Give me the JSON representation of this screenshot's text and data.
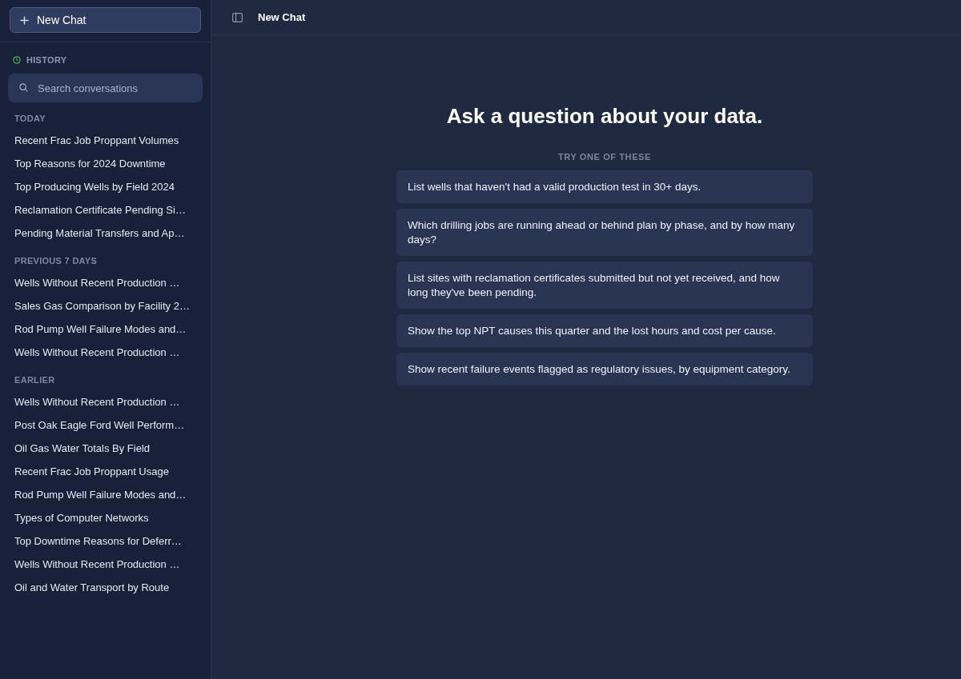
{
  "sidebar": {
    "new_chat_button": {
      "label": "New Chat"
    },
    "history": {
      "title": "HISTORY",
      "search": {
        "placeholder": "Search conversations"
      },
      "groups": [
        {
          "title": "TODAY",
          "items": [
            {
              "label": "Recent Frac Job Proppant Volumes",
              "selected": false
            },
            {
              "label": "Top Reasons for 2024 Downtime",
              "selected": false
            },
            {
              "label": "Top Producing Wells by Field 2024",
              "selected": false
            },
            {
              "label": "Reclamation Certificate Pending Si…",
              "selected": false
            },
            {
              "label": "Pending Material Transfers and Ap…",
              "selected": false
            }
          ]
        },
        {
          "title": "PREVIOUS 7 DAYS",
          "items": [
            {
              "label": "Wells Without Recent Production …",
              "selected": false
            },
            {
              "label": "Sales Gas Comparison by Facility 2…",
              "selected": false
            },
            {
              "label": "Rod Pump Well Failure Modes and…",
              "selected": false
            },
            {
              "label": "Wells Without Recent Production …",
              "selected": false
            }
          ]
        },
        {
          "title": "EARLIER",
          "items": [
            {
              "label": "Wells Without Recent Production …",
              "selected": false
            },
            {
              "label": "Post Oak Eagle Ford Well Perform…",
              "selected": false
            },
            {
              "label": "Oil Gas Water Totals By Field",
              "selected": false
            },
            {
              "label": "Recent Frac Job Proppant Usage",
              "selected": false
            },
            {
              "label": "Rod Pump Well Failure Modes and…",
              "selected": false
            },
            {
              "label": "Types of Computer Networks",
              "selected": false
            },
            {
              "label": "Top Downtime Reasons for Deferr…",
              "selected": false
            },
            {
              "label": "Wells Without Recent Production …",
              "selected": false
            },
            {
              "label": "Oil and Water Transport by Route",
              "selected": false
            }
          ]
        }
      ]
    }
  },
  "header": {
    "title": "New Chat"
  },
  "main": {
    "heading": "Ask a question about your data.",
    "suggestions_title": "TRY ONE OF THESE",
    "suggestions": [
      "List wells that haven't had a valid production test in 30+ days.",
      "Which drilling jobs are running ahead or behind plan by phase, and by how many days?",
      "List sites with reclamation certificates submitted but not yet received, and how long they've been pending.",
      "Show the top NPT causes this quarter and the lost hours and cost per cause.",
      "Show recent failure events flagged as regulatory issues, by equipment category."
    ]
  }
}
